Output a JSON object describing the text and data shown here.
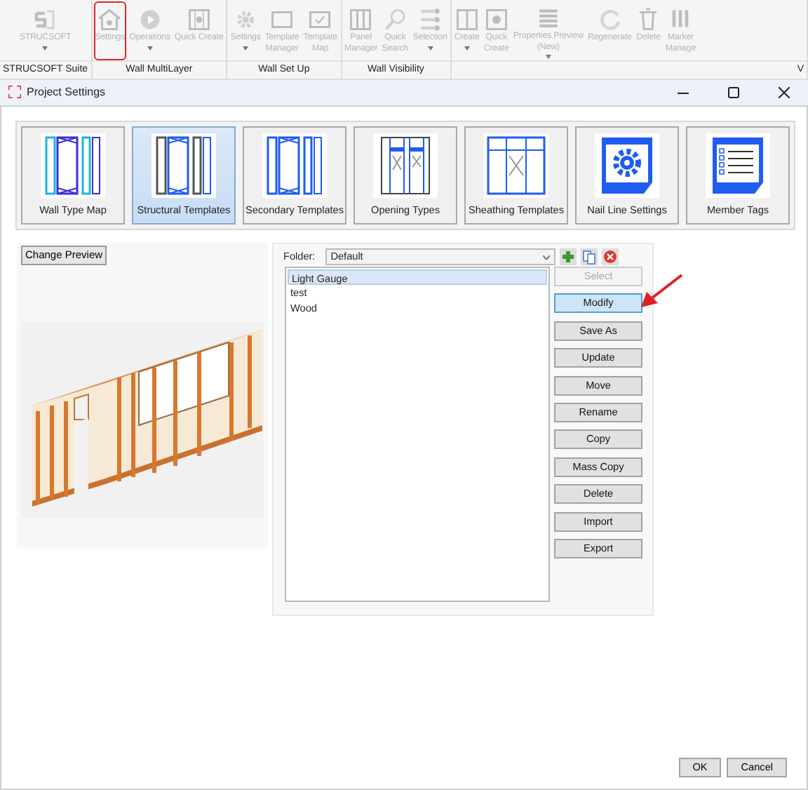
{
  "ribbon": {
    "groups": [
      {
        "label": "STRUCSOFT Suite",
        "items": [
          {
            "lines": [
              "STRUCSOFT"
            ],
            "dropdown": true,
            "disabled": true,
            "annotated": false
          }
        ]
      },
      {
        "label": "Wall MultiLayer",
        "items": [
          {
            "lines": [
              "Settings"
            ],
            "dropdown": false,
            "disabled": true,
            "annotated": true
          },
          {
            "lines": [
              "Operations"
            ],
            "dropdown": true,
            "disabled": true,
            "annotated": false
          },
          {
            "lines": [
              "Quick Create"
            ],
            "dropdown": false,
            "disabled": true,
            "annotated": false
          }
        ]
      },
      {
        "label": "Wall Set Up",
        "items": [
          {
            "lines": [
              "Settings"
            ],
            "dropdown": true,
            "disabled": true,
            "annotated": false
          },
          {
            "lines": [
              "Template",
              "Manager"
            ],
            "dropdown": false,
            "disabled": true,
            "annotated": false
          },
          {
            "lines": [
              "Template",
              "Map"
            ],
            "dropdown": false,
            "disabled": true,
            "annotated": false
          }
        ]
      },
      {
        "label": "Wall Visibility",
        "items": [
          {
            "lines": [
              "Panel",
              "Manager"
            ],
            "dropdown": false,
            "disabled": true,
            "annotated": false
          },
          {
            "lines": [
              "Quick",
              "Search"
            ],
            "dropdown": false,
            "disabled": true,
            "annotated": false
          },
          {
            "lines": [
              "Selection"
            ],
            "dropdown": true,
            "disabled": true,
            "annotated": false
          }
        ]
      },
      {
        "label": "V",
        "items": [
          {
            "lines": [
              "Create"
            ],
            "dropdown": true,
            "disabled": true,
            "annotated": false
          },
          {
            "lines": [
              "Quick",
              "Create"
            ],
            "dropdown": false,
            "disabled": true,
            "annotated": false
          },
          {
            "lines": [
              "Properties Preview",
              "(New)"
            ],
            "dropdown": true,
            "disabled": true,
            "annotated": false
          },
          {
            "lines": [
              "Regenerate"
            ],
            "dropdown": false,
            "disabled": true,
            "annotated": false
          },
          {
            "lines": [
              "Delete"
            ],
            "dropdown": false,
            "disabled": true,
            "annotated": false
          },
          {
            "lines": [
              "Marker",
              "Manage"
            ],
            "dropdown": false,
            "disabled": true,
            "annotated": false
          }
        ]
      }
    ]
  },
  "window": {
    "title": "Project Settings"
  },
  "tiles": [
    {
      "label": "Wall Type Map",
      "selected": false
    },
    {
      "label": "Structural Templates",
      "selected": true
    },
    {
      "label": "Secondary Templates",
      "selected": false
    },
    {
      "label": "Opening Types",
      "selected": false
    },
    {
      "label": "Sheathing Templates",
      "selected": false
    },
    {
      "label": "Nail Line Settings",
      "selected": false
    },
    {
      "label": "Member Tags",
      "selected": false
    }
  ],
  "preview": {
    "button": "Change Preview",
    "kind": "picture"
  },
  "folder": {
    "label": "Folder:",
    "value": "Default"
  },
  "templates": [
    {
      "name": "Light Gauge",
      "selected": true
    },
    {
      "name": "test",
      "selected": false
    },
    {
      "name": "Wood",
      "selected": false
    }
  ],
  "buttons": [
    {
      "label": "Select",
      "disabled": true,
      "focused": false,
      "annotated": false
    },
    {
      "label": "Modify",
      "disabled": false,
      "focused": true,
      "annotated": true
    },
    {
      "label": "Save As",
      "disabled": false,
      "focused": false,
      "annotated": false
    },
    {
      "label": "Update",
      "disabled": false,
      "focused": false,
      "annotated": false
    },
    {
      "label": "Move",
      "disabled": false,
      "focused": false,
      "annotated": false
    },
    {
      "label": "Rename",
      "disabled": false,
      "focused": false,
      "annotated": false
    },
    {
      "label": "Copy",
      "disabled": false,
      "focused": false,
      "annotated": false
    },
    {
      "label": "Mass Copy",
      "disabled": false,
      "focused": false,
      "annotated": false
    },
    {
      "label": "Delete",
      "disabled": false,
      "focused": false,
      "annotated": false
    },
    {
      "label": "Import",
      "disabled": false,
      "focused": false,
      "annotated": false
    },
    {
      "label": "Export",
      "disabled": false,
      "focused": false,
      "annotated": false
    }
  ],
  "footer": [
    "OK",
    "Cancel"
  ]
}
